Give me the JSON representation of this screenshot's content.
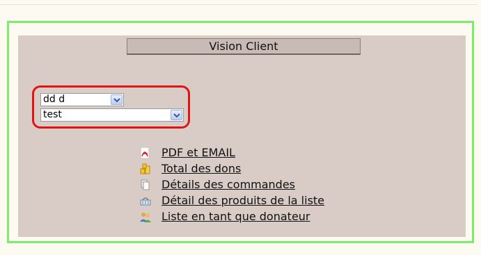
{
  "panel": {
    "title": "Vision Client"
  },
  "selects": {
    "first": {
      "value": "dd d"
    },
    "second": {
      "value": "test"
    }
  },
  "links": [
    {
      "label": "PDF et EMAIL",
      "icon": "pdf-icon"
    },
    {
      "label": "Total des dons",
      "icon": "coins-icon"
    },
    {
      "label": "Détails des commandes",
      "icon": "documents-icon"
    },
    {
      "label": "Détail des produits de la liste",
      "icon": "basket-icon"
    },
    {
      "label": "Liste en tant que donateur",
      "icon": "users-icon"
    }
  ],
  "colors": {
    "panel_border": "#7dec6e",
    "inner_bg": "#d9ccc7",
    "highlight": "#e01414"
  }
}
